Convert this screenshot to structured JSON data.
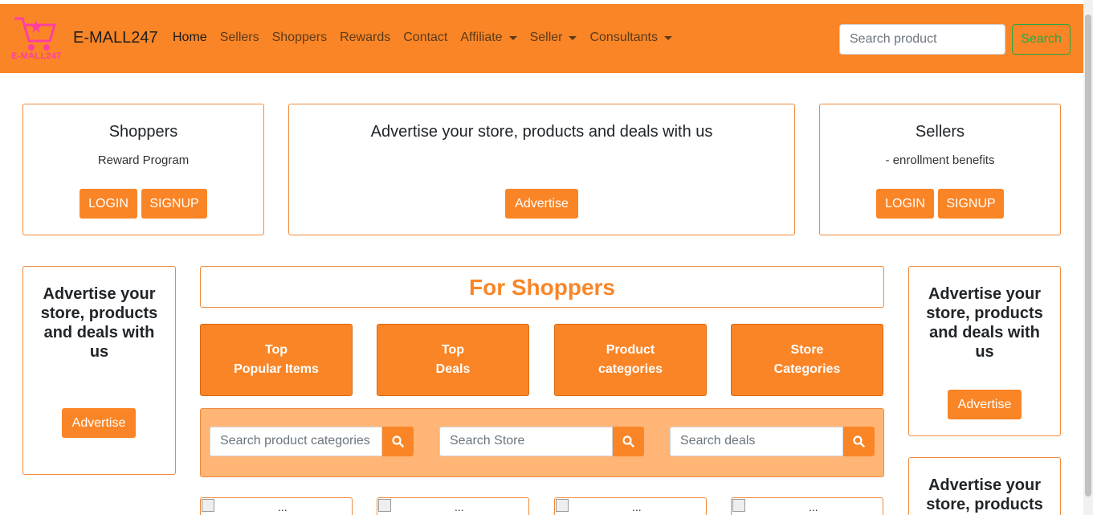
{
  "brand": {
    "logo_text": "E-MALL247",
    "name": "E-MALL247"
  },
  "nav": {
    "items": [
      {
        "label": "Home"
      },
      {
        "label": "Sellers"
      },
      {
        "label": "Shoppers"
      },
      {
        "label": "Rewards"
      },
      {
        "label": "Contact"
      },
      {
        "label": "Affiliate"
      },
      {
        "label": "Seller"
      },
      {
        "label": "Consultants"
      }
    ],
    "search_placeholder": "Search product",
    "search_button": "Search"
  },
  "cards": {
    "shoppers": {
      "title": "Shoppers",
      "subtitle": "Reward Program",
      "login": "LOGIN",
      "signup": "SIGNUP"
    },
    "advertise_main": {
      "title": "Advertise your store, products and deals with us",
      "button": "Advertise"
    },
    "sellers": {
      "title": "Sellers",
      "subtitle": "- enrollment benefits",
      "login": "LOGIN",
      "signup": "SIGNUP"
    }
  },
  "side_ads": {
    "left": {
      "title": "Advertise your store, products and deals with us",
      "button": "Advertise"
    },
    "right_top": {
      "title": "Advertise your store, products and deals with us",
      "button": "Advertise"
    },
    "right_bottom": {
      "title": "Advertise your store, products"
    }
  },
  "for_shoppers": {
    "heading": "For Shoppers",
    "tiles": [
      {
        "line1": "Top",
        "line2": "Popular Items"
      },
      {
        "line1": "Top",
        "line2": "Deals"
      },
      {
        "line1": "Product",
        "line2": "categories"
      },
      {
        "line1": "Store",
        "line2": "Categories"
      }
    ],
    "searches": [
      {
        "placeholder": "Search product categories"
      },
      {
        "placeholder": "Search Store"
      },
      {
        "placeholder": "Search deals"
      }
    ],
    "thumb_placeholder": "..."
  },
  "colors": {
    "accent": "#fa8526",
    "panel": "#ffb575",
    "border": "#f08a3b"
  }
}
